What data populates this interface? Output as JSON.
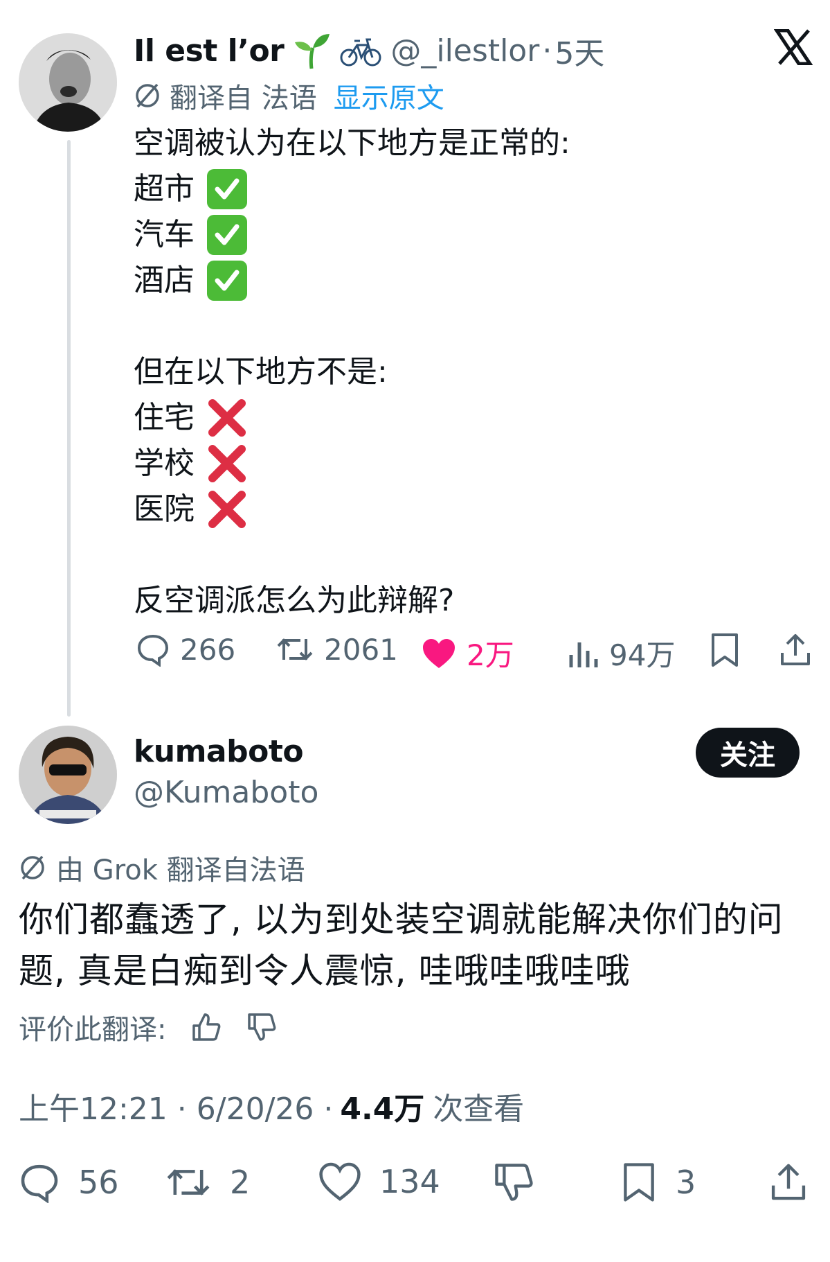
{
  "tweet": {
    "author_name": "Il est l’or",
    "name_emojis": [
      "seedling-emoji",
      "bicycle-emoji"
    ],
    "handle": "@_ilestlor",
    "separator": "·",
    "time_ago": "5天",
    "translated_label": "翻译自 法语",
    "show_original": "显示原文",
    "intro": "空调被认为在以下地方是正常的:",
    "yes_items": [
      "超市",
      "汽车",
      "酒店"
    ],
    "no_intro": "但在以下地方不是:",
    "no_items": [
      "住宅",
      "学校",
      "医院"
    ],
    "question": "反空调派怎么为此辩解?",
    "metrics": {
      "replies": "266",
      "retweets": "2061",
      "likes": "2万",
      "views": "94万"
    },
    "colors": {
      "like": "#f91880",
      "check": "#4cbb37",
      "cross": "#dd2e44"
    }
  },
  "reply": {
    "author_name": "kumaboto",
    "handle": "@Kumaboto",
    "follow_label": "关注",
    "translated_label": "由 Grok 翻译自法语",
    "text": "你们都蠢透了, 以为到处装空调就能解决你们的问题, 真是白痴到令人震惊, 哇哦哇哦哇哦",
    "rate_label": "评价此翻译:",
    "timestamp": "上午12:21 · 6/20/26 · ",
    "view_count": "4.4万",
    "view_suffix": "次查看",
    "metrics": {
      "replies": "56",
      "retweets": "2",
      "likes": "134",
      "bookmarks": "3"
    }
  }
}
